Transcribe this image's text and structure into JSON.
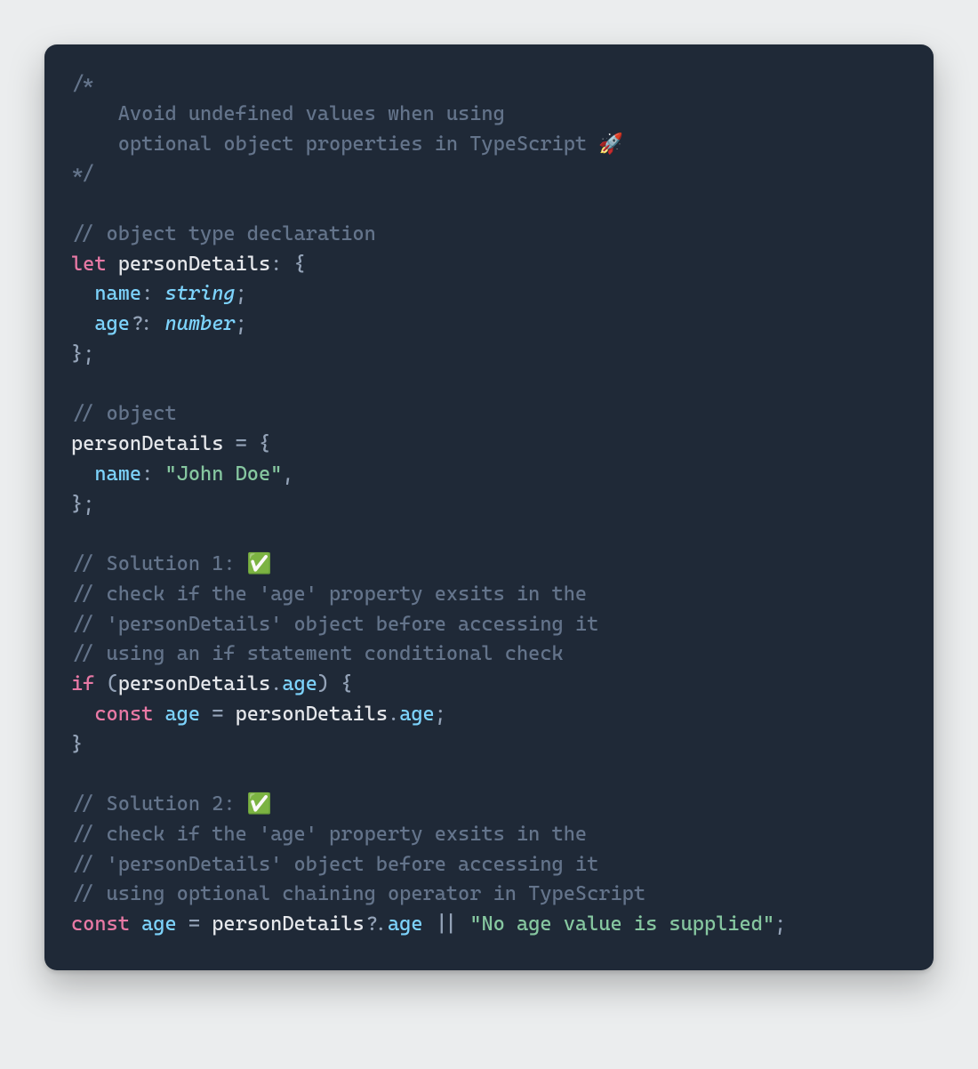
{
  "code": {
    "c1": "/*",
    "c2": "    Avoid undefined values when using",
    "c3": "    optional object properties in TypeScript 🚀",
    "c4": "*/",
    "c5": "// object type declaration",
    "kw_let": "let",
    "ident_personDetails": "personDetails",
    "colon": ":",
    "brace_open": "{",
    "prop_name": "name",
    "type_string": "string",
    "semi": ";",
    "prop_age": "age",
    "qmark": "?",
    "type_number": "number",
    "brace_close": "}",
    "c6": "// object",
    "eq": "=",
    "str_john": "\"John Doe\"",
    "comma": ",",
    "c7": "// Solution 1: ✅",
    "c8": "// check if the 'age' property exsits in the",
    "c9": "// 'personDetails' object before accessing it",
    "c10": "// using an if statement conditional check",
    "kw_if": "if",
    "paren_open": "(",
    "dot": ".",
    "paren_close": ")",
    "kw_const": "const",
    "ident_age": "age",
    "c11": "// Solution 2: ✅",
    "c12": "// check if the 'age' property exsits in the",
    "c13": "// 'personDetails' object before accessing it",
    "c14": "// using optional chaining operator in TypeScript",
    "qdot": "?.",
    "or": "||",
    "str_noage": "\"No age value is supplied\""
  }
}
